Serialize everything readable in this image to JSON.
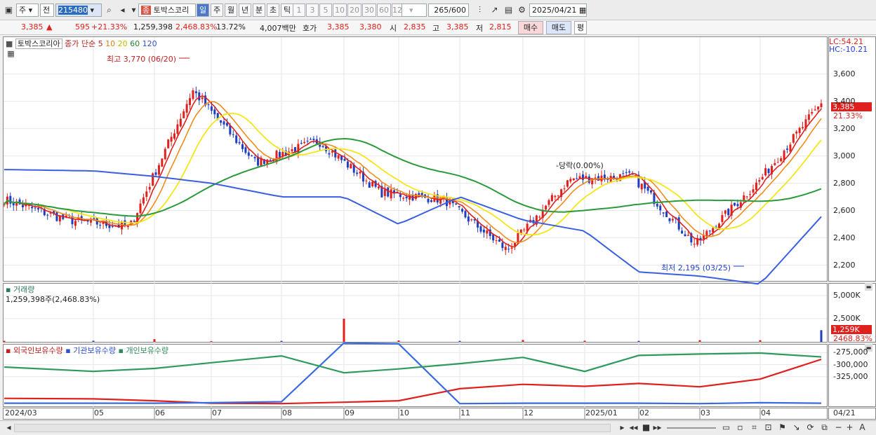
{
  "toolbar": {
    "period_select": "주",
    "prev_label": "전",
    "code_value": "215480",
    "stock_badge": "종",
    "stock_name": "토박스코리",
    "period_tabs": [
      "일",
      "주",
      "월",
      "년",
      "분",
      "초",
      "틱"
    ],
    "active_tab": "일",
    "interval_buttons": [
      "1",
      "3",
      "5",
      "10",
      "20",
      "30",
      "60",
      "120"
    ],
    "count_value": "265",
    "count_total": "/600",
    "date_value": "2025/04/21"
  },
  "quote": {
    "price": "3,385",
    "arrow": "▲",
    "change": "595",
    "change_pct": "+21.33%",
    "volume": "1,259,398",
    "volume_ratio": "2,468.83%",
    "turnover": "13.72%",
    "amount": "4,007백만",
    "hoga_label": "호가",
    "ask": "3,385",
    "bid": "3,380",
    "open_label": "시",
    "open": "2,835",
    "high_label": "고",
    "high": "3,385",
    "low_label": "저",
    "low": "2,815",
    "buy_label": "매수",
    "sell_label": "매도",
    "avg_label": "평"
  },
  "price_pane": {
    "stock_label": "토박스코리아",
    "ma_title": "종가 단순",
    "ma_periods": [
      "5",
      "10",
      "20",
      "60",
      "120"
    ],
    "lc_label": "LC:54.21",
    "hc_label": "HC:-10.21",
    "high_annotation": "최고 3,770 (06/20)",
    "low_annotation": "최저 2,195 (03/25)",
    "mid_annotation": "-당락(0.00%)",
    "current_price_tag": "3,385",
    "current_pct_tag": "21.33%"
  },
  "volume_pane": {
    "title": "거래량",
    "value_text": "1,259,398주(2,468.83%)",
    "current_tag": "1,259K",
    "current_pct_tag": "2468.83%"
  },
  "holding_pane": {
    "series_labels": [
      "외국인보유수량",
      "기관보유수량",
      "개인보유수량"
    ]
  },
  "x_axis": {
    "labels": [
      "2024/03",
      "05",
      "06",
      "07",
      "08",
      "09",
      "10",
      "11",
      "12",
      "2025/01",
      "02",
      "03",
      "04",
      "04/21"
    ]
  },
  "colors": {
    "up": "#e0201c",
    "down": "#1f3fbf",
    "ma5": "#e0201c",
    "ma10": "#f08c1c",
    "ma20": "#f5e618",
    "ma60": "#2a9a3a",
    "ma120": "#3a5fe0",
    "foreign": "#e0201c",
    "inst": "#3a6be0",
    "retail": "#2e9a5e"
  },
  "chart_data": [
    {
      "type": "line",
      "title": "토박스코리아 일봉",
      "x": [
        "2024/03",
        "05",
        "06",
        "07",
        "08",
        "09",
        "10",
        "11",
        "12",
        "2025/01",
        "02",
        "03",
        "04",
        "04/21"
      ],
      "series": [
        {
          "name": "종가",
          "values": [
            2680,
            2530,
            2480,
            3480,
            2950,
            3110,
            2730,
            2680,
            2310,
            2830,
            2850,
            2350,
            2810,
            3385
          ]
        },
        {
          "name": "120",
          "values": [
            2900,
            2890,
            2850,
            2800,
            2700,
            2700,
            2500,
            2700,
            2530,
            2450,
            2150,
            2120,
            2060,
            2555
          ]
        }
      ],
      "ylim": [
        2100,
        3870
      ],
      "y_ticks": [
        "3,600",
        "3,400",
        "3,200",
        "3,000",
        "2,800",
        "2,600",
        "2,400",
        "2,200"
      ],
      "annotations": [
        "최고 3,770 (06/20)",
        "최저 2,195 (03/25)"
      ]
    },
    {
      "type": "bar",
      "title": "거래량",
      "values": [
        110000,
        120000,
        290000,
        80000,
        100000,
        2500000,
        150000,
        100000,
        200000,
        120000,
        100000,
        180000,
        180000,
        1259398
      ],
      "ylim": [
        0,
        6200000
      ],
      "y_ticks": [
        "5,000K",
        "2,500K"
      ]
    },
    {
      "type": "line",
      "title": "보유수량",
      "x": [
        "2024/03",
        "05",
        "06",
        "07",
        "08",
        "09",
        "10",
        "11",
        "12",
        "2025/01",
        "02",
        "03",
        "04",
        "04/21"
      ],
      "series": [
        {
          "name": "외국인보유수량",
          "values": [
            -370000,
            -371000,
            -375000,
            -380000,
            -381000,
            -378000,
            -375000,
            -350000,
            -341000,
            -345000,
            -339000,
            -346000,
            -330000,
            -289000
          ]
        },
        {
          "name": "기관보유수량",
          "values": [
            -380000,
            -380000,
            -380000,
            -379000,
            -377000,
            -255000,
            -257000,
            -381000,
            -380000,
            -380000,
            -380000,
            -381000,
            -379000,
            -380000
          ]
        },
        {
          "name": "개인보유수량",
          "values": [
            -305000,
            -314000,
            -308000,
            -296000,
            -282000,
            -317000,
            -309000,
            -298000,
            -285000,
            -314000,
            -281000,
            -278000,
            -276000,
            -284000
          ]
        }
      ],
      "ylim": [
        -385000,
        -260000
      ],
      "y_ticks": [
        "-275,000",
        "-300,000",
        "-325,000"
      ]
    }
  ]
}
